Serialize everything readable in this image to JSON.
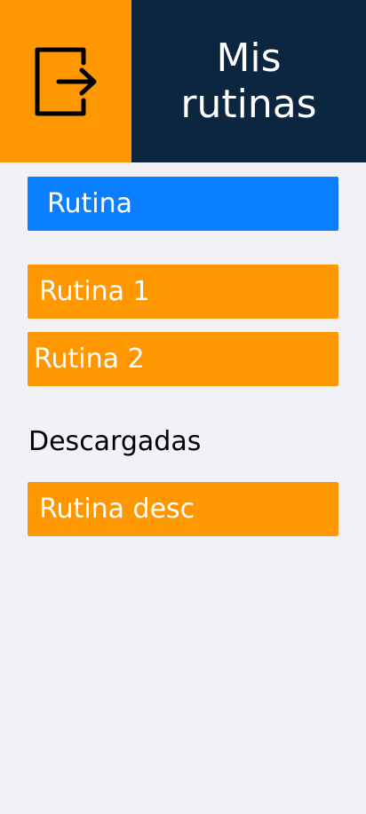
{
  "header": {
    "logout_icon": "logout-icon",
    "title": "Mis rutinas",
    "title_bg": "#0c2640",
    "logout_bg": "#ff9800"
  },
  "actions": {
    "new_routine_label": "Rutina",
    "new_routine_color": "#0a7fff"
  },
  "my_routines": [
    {
      "label": "Rutina 1"
    },
    {
      "label": "Rutina 2"
    }
  ],
  "downloaded": {
    "section_label": "Descargadas",
    "items": [
      {
        "label": "Rutina desc"
      }
    ]
  },
  "colors": {
    "accent": "#ff9800",
    "primary": "#0a7fff",
    "background": "#f2f1f6"
  }
}
